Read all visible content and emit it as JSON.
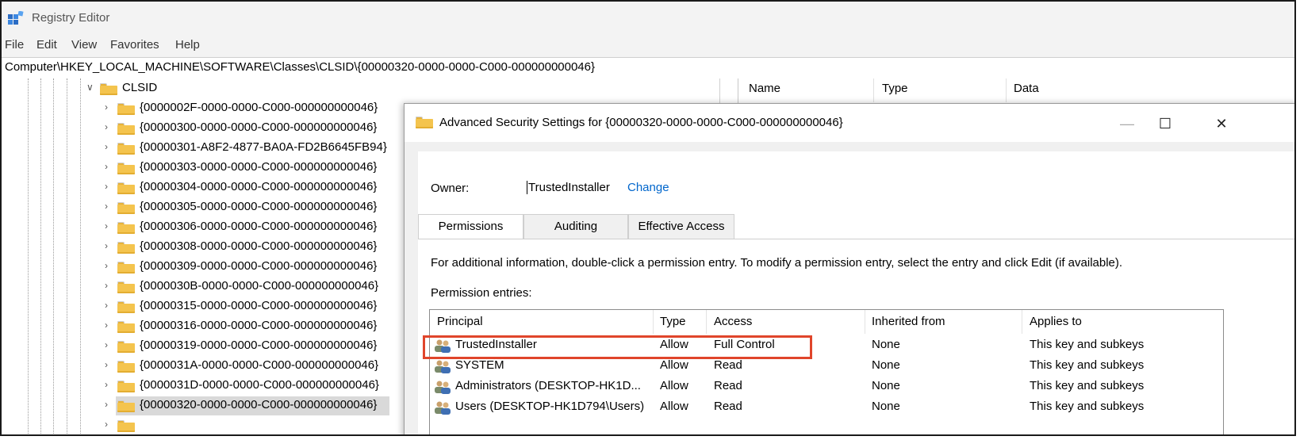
{
  "app": {
    "title": "Registry Editor",
    "menu": [
      "File",
      "Edit",
      "View",
      "Favorites",
      "Help"
    ],
    "address": "Computer\\HKEY_LOCAL_MACHINE\\SOFTWARE\\Classes\\CLSID\\{00000320-0000-0000-C000-000000000046}"
  },
  "tree": {
    "parent": "CLSID",
    "items": [
      "{0000002F-0000-0000-C000-000000000046}",
      "{00000300-0000-0000-C000-000000000046}",
      "{00000301-A8F2-4877-BA0A-FD2B6645FB94}",
      "{00000303-0000-0000-C000-000000000046}",
      "{00000304-0000-0000-C000-000000000046}",
      "{00000305-0000-0000-C000-000000000046}",
      "{00000306-0000-0000-C000-000000000046}",
      "{00000308-0000-0000-C000-000000000046}",
      "{00000309-0000-0000-C000-000000000046}",
      "{0000030B-0000-0000-C000-000000000046}",
      "{00000315-0000-0000-C000-000000000046}",
      "{00000316-0000-0000-C000-000000000046}",
      "{00000319-0000-0000-C000-000000000046}",
      "{0000031A-0000-0000-C000-000000000046}",
      "{0000031D-0000-0000-C000-000000000046}",
      "{00000320-0000-0000-C000-000000000046}"
    ],
    "selected_index": 15
  },
  "values_pane": {
    "columns": [
      "Name",
      "Type",
      "Data"
    ]
  },
  "dialog": {
    "title": "Advanced Security Settings for {00000320-0000-0000-C000-000000000046}",
    "minimize": "—",
    "maximize": "☐",
    "close": "✕",
    "owner_label": "Owner:",
    "owner_value": "TrustedInstaller",
    "owner_change": "Change",
    "tabs": [
      "Permissions",
      "Auditing",
      "Effective Access"
    ],
    "active_tab": "Permissions",
    "info": "For additional information, double-click a permission entry. To modify a permission entry, select the entry and click Edit (if available).",
    "entries_label": "Permission entries:",
    "table": {
      "headers": [
        "Principal",
        "Type",
        "Access",
        "Inherited from",
        "Applies to"
      ],
      "rows": [
        {
          "principal": "TrustedInstaller",
          "type": "Allow",
          "access": "Full Control",
          "inherited": "None",
          "applies": "This key and subkeys"
        },
        {
          "principal": "SYSTEM",
          "type": "Allow",
          "access": "Read",
          "inherited": "None",
          "applies": "This key and subkeys"
        },
        {
          "principal": "Administrators (DESKTOP-HK1D...",
          "type": "Allow",
          "access": "Read",
          "inherited": "None",
          "applies": "This key and subkeys"
        },
        {
          "principal": "Users (DESKTOP-HK1D794\\Users)",
          "type": "Allow",
          "access": "Read",
          "inherited": "None",
          "applies": "This key and subkeys"
        }
      ]
    }
  },
  "colors": {
    "highlight_box": "#e0452b",
    "link": "#0066cc",
    "folder": "#f4c44e"
  }
}
